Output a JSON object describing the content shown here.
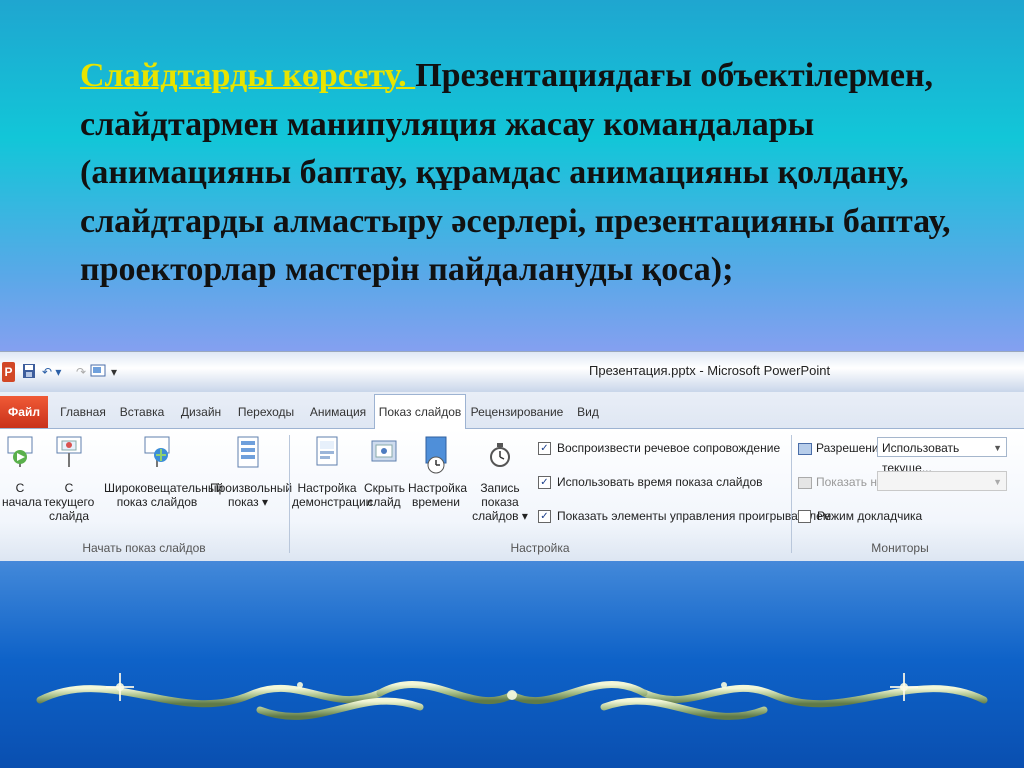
{
  "slide": {
    "heading_highlight": "Слайдтарды көрсету. ",
    "heading_rest": "Презентациядағы объектілермен, слайдтармен манипуляция жасау командалары (анимацияны баптау, құрамдас анимацияны қолдану, слайдтарды алмастыру әсерлері, презентацияны баптау, проекторлар мастерін пайдалануды қоса);"
  },
  "app": {
    "logo": "P",
    "title": "Презентация.pptx - Microsoft PowerPoint",
    "qat_undo": "↶ ▾",
    "qat_more": "▾"
  },
  "tabs": [
    "Файл",
    "Главная",
    "Вставка",
    "Дизайн",
    "Переходы",
    "Анимация",
    "Показ слайдов",
    "Рецензирование",
    "Вид"
  ],
  "groups": {
    "start": {
      "label": "Начать показ слайдов",
      "from_start": [
        "С",
        "начала"
      ],
      "from_current": [
        "С текущего",
        "слайда"
      ],
      "broadcast": [
        "Широковещательный",
        "показ слайдов"
      ],
      "custom": [
        "Произвольный",
        "показ ▾"
      ]
    },
    "setup": {
      "label": "Настройка",
      "setup_show": [
        "Настройка",
        "демонстрации"
      ],
      "hide_slide": [
        "Скрыть",
        "слайд"
      ],
      "rehearse": [
        "Настройка",
        "времени"
      ],
      "record": [
        "Запись показа",
        "слайдов ▾"
      ],
      "check_narration": "Воспроизвести речевое сопровождение",
      "check_timings": "Использовать время показа слайдов",
      "check_controls": "Показать элементы управления проигрывателем"
    },
    "monitors": {
      "label": "Мониторы",
      "resolution_label": "Разрешение:",
      "resolution_value": "Использовать текуще...",
      "show_on_label": "Показать на:",
      "presenter_view": "Режим докладчика"
    }
  },
  "colors": {
    "highlight": "#e8e400",
    "file_tab": "#d24726"
  },
  "icons": [
    "powerpoint-logo-icon",
    "save-icon",
    "undo-icon",
    "projector-icon",
    "broadcast-icon",
    "custom-show-icon",
    "setup-icon",
    "hide-slide-icon",
    "rehearse-icon",
    "record-icon",
    "checkbox-checked-icon",
    "resolution-icon",
    "monitor-icon",
    "ornament-decoration"
  ]
}
